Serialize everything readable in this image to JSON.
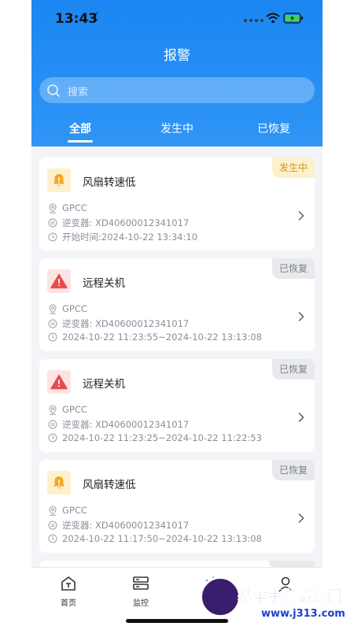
{
  "status_bar": {
    "time": "13:43"
  },
  "header": {
    "title": "报警",
    "search_placeholder": "搜索",
    "tabs": [
      {
        "label": "全部",
        "active": true
      },
      {
        "label": "发生中",
        "active": false
      },
      {
        "label": "已恢复",
        "active": false
      }
    ]
  },
  "alarms": [
    {
      "type": "warning",
      "title": "风扇转速低",
      "status": "发生中",
      "site": "GPCC",
      "inverter": "逆变器: XD40600012341017",
      "time": "开始时间:2024-10-22 13:34:10"
    },
    {
      "type": "error",
      "title": "远程关机",
      "status": "已恢复",
      "site": "GPCC",
      "inverter": "逆变器: XD40600012341017",
      "time": "2024-10-22 11:23:55~2024-10-22 13:13:08"
    },
    {
      "type": "error",
      "title": "远程关机",
      "status": "已恢复",
      "site": "GPCC",
      "inverter": "逆变器: XD40600012341017",
      "time": "2024-10-22 11:23:25~2024-10-22 11:22:53"
    },
    {
      "type": "warning",
      "title": "风扇转速低",
      "status": "已恢复",
      "site": "GPCC",
      "inverter": "逆变器: XD40600012341017",
      "time": "2024-10-22 11:17:50~2024-10-22 13:13:08"
    }
  ],
  "tabbar": {
    "items": [
      {
        "label": "首页",
        "icon": "home-icon"
      },
      {
        "label": "监控",
        "icon": "monitor-icon"
      },
      {
        "label": "",
        "icon": "alarm-icon"
      },
      {
        "label": "",
        "icon": "user-icon"
      }
    ]
  },
  "watermark": {
    "line1": "基伞手游资源网",
    "line2": "www.j313.com"
  },
  "colors": {
    "header_blue": "#1b86f2",
    "warning_bg": "#fdf0cc",
    "warning_text": "#d49a10",
    "error_icon": "#e74c4c",
    "recovered_bg": "#e7e9ec"
  }
}
